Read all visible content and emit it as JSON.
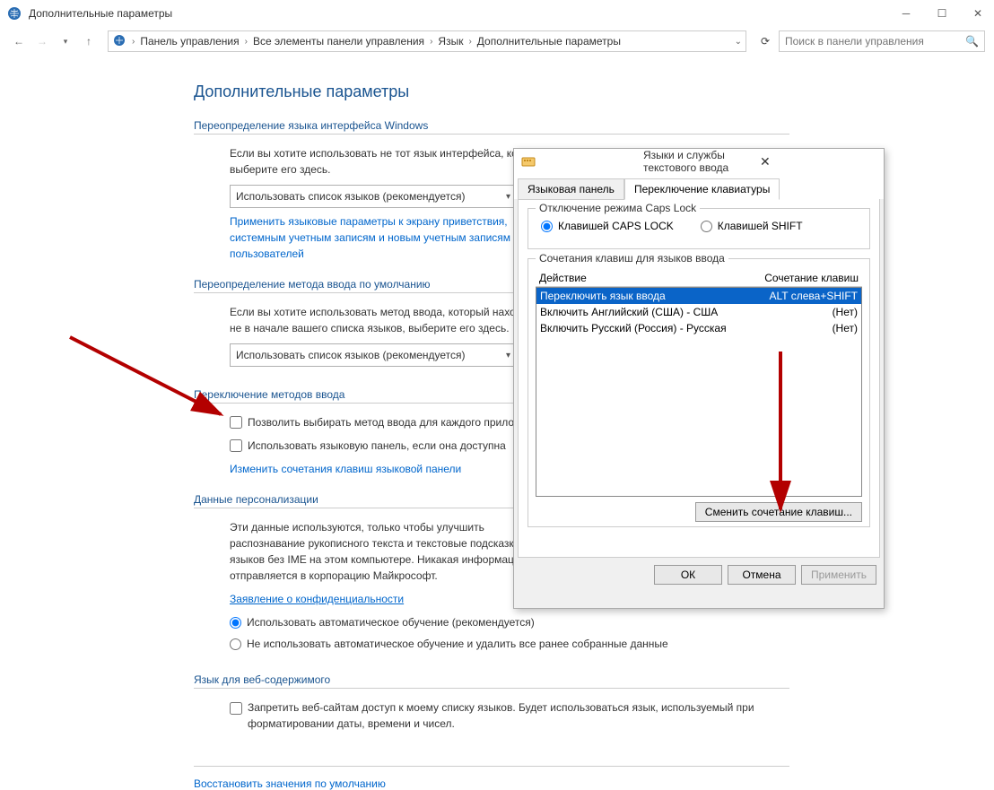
{
  "window": {
    "title": "Дополнительные параметры",
    "breadcrumbs": [
      "Панель управления",
      "Все элементы панели управления",
      "Язык",
      "Дополнительные параметры"
    ],
    "search_placeholder": "Поиск в панели управления"
  },
  "page": {
    "heading": "Дополнительные параметры",
    "sections": {
      "override_ui_lang": {
        "title": "Переопределение языка интерфейса Windows",
        "text": "Если вы хотите использовать не тот язык интерфейса, который определен порядком в вашем списке языков, выберите его здесь.",
        "dropdown": "Использовать список языков (рекомендуется)",
        "link": "Применить языковые параметры к экрану приветствия, системным учетным записям и новым учетным записям пользователей"
      },
      "override_input": {
        "title": "Переопределение метода ввода по умолчанию",
        "text": "Если вы хотите использовать метод ввода, который находится не в начале вашего списка языков, выберите его здесь.",
        "dropdown": "Использовать список языков (рекомендуется)"
      },
      "switch_methods": {
        "title": "Переключение методов ввода",
        "check1": "Позволить выбирать метод ввода для каждого приложения",
        "check2": "Использовать языковую панель, если она доступна",
        "link": "Изменить сочетания клавиш языковой панели"
      },
      "personalization": {
        "title": "Данные персонализации",
        "text": "Эти данные используются, только чтобы улучшить распознавание рукописного текста и текстовые подсказки для языков без IME на этом компьютере. Никакая информация не отправляется в корпорацию Майкрософт.",
        "link": "Заявление о конфиденциальности",
        "radio1": "Использовать автоматическое обучение (рекомендуется)",
        "radio2": "Не использовать автоматическое обучение и удалить все ранее собранные данные"
      },
      "web_lang": {
        "title": "Язык для веб-содержимого",
        "check": "Запретить веб-сайтам доступ к моему списку языков. Будет использоваться язык, используемый при форматировании даты, времени и чисел."
      },
      "restore_link": "Восстановить значения по умолчанию"
    }
  },
  "dialog": {
    "title": "Языки и службы текстового ввода",
    "tabs": [
      "Языковая панель",
      "Переключение клавиатуры"
    ],
    "active_tab": 1,
    "capslock_group": {
      "title": "Отключение режима Caps Lock",
      "radio1": "Клавишей CAPS LOCK",
      "radio2": "Клавишей SHIFT"
    },
    "hotkeys_group": {
      "title": "Сочетания клавиш для языков ввода",
      "col1": "Действие",
      "col2": "Сочетание клавиш",
      "rows": [
        {
          "action": "Переключить язык ввода",
          "key": "ALT слева+SHIFT",
          "selected": true
        },
        {
          "action": "Включить Английский (США) - США",
          "key": "(Нет)",
          "selected": false
        },
        {
          "action": "Включить Русский (Россия) - Русская",
          "key": "(Нет)",
          "selected": false
        }
      ],
      "change_btn": "Сменить сочетание клавиш..."
    },
    "buttons": {
      "ok": "ОК",
      "cancel": "Отмена",
      "apply": "Применить"
    }
  }
}
